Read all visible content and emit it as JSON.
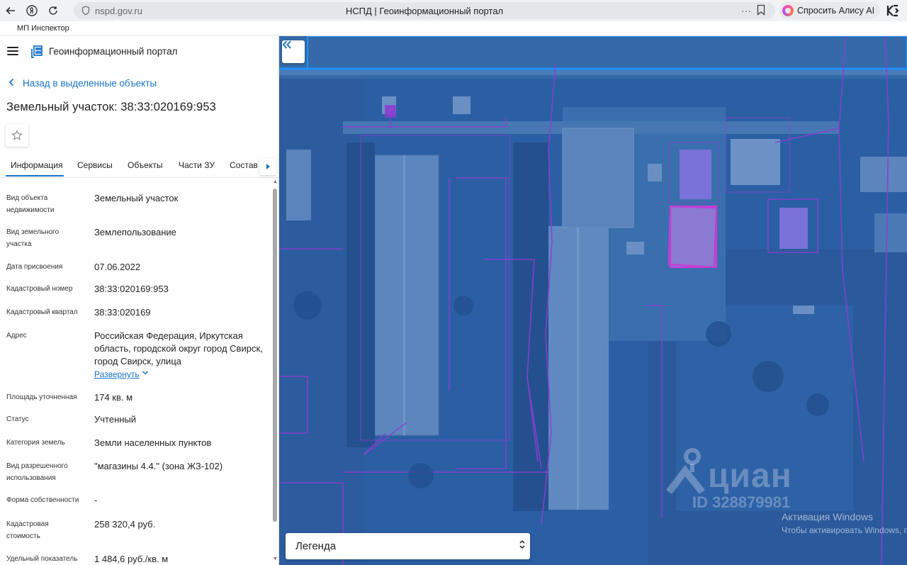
{
  "browser": {
    "url": "nspd.gov.ru",
    "tab_title": "НСПД | Геоинформационный портал",
    "more": "···",
    "alice_label": "Спросить Алису AI",
    "bookmark": "МП Инспектор"
  },
  "header": {
    "app_name": "Геоинформационный портал"
  },
  "panel": {
    "back_label": "Назад в выделенные объекты",
    "title": "Земельный участок: 38:33:020169:953",
    "tabs": [
      "Информация",
      "Сервисы",
      "Объекты",
      "Части ЗУ",
      "Состав"
    ],
    "active_tab": "Информация",
    "rows": [
      {
        "key": "Вид объекта недвижимости",
        "value": "Земельный участок"
      },
      {
        "key": "Вид земельного участка",
        "value": "Землепользование"
      },
      {
        "key": "Дата присвоения",
        "value": "07.06.2022"
      },
      {
        "key": "Кадастровый номер",
        "value": "38:33:020169:953"
      },
      {
        "key": "Кадастровый квартал",
        "value": "38:33:020169"
      },
      {
        "key": "Адрес",
        "value": "Российская Федерация, Иркутская область, городской округ город Свирск, город Свирск, улица"
      },
      {
        "key": "Площадь уточненная",
        "value": "174 кв. м"
      },
      {
        "key": "Статус",
        "value": "Учтенный"
      },
      {
        "key": "Категория земель",
        "value": "Земли населенных пунктов"
      },
      {
        "key": "Вид разрешенного использования",
        "value": "\"магазины 4.4.\" (зона ЖЗ-102)"
      },
      {
        "key": "Форма собственности",
        "value": "-"
      },
      {
        "key": "Кадастровая стоимость",
        "value": "258 320,4 руб."
      },
      {
        "key": "Удельный показатель",
        "value": "1 484,6 руб./кв. м"
      }
    ],
    "expand_label": "Развернуть"
  },
  "map": {
    "legend_label": "Легенда",
    "watermark_name": "циан",
    "watermark_id": "ID 328879981",
    "os_notice_title": "Активация Windows",
    "os_notice_text": "Чтобы активировать Windows, п"
  },
  "colors": {
    "accent": "#1a73c8",
    "map_tint": "#2a5ea3",
    "parcel_line": "#8a3fd1",
    "selected_parcel": "#c83ad6",
    "highlight_border": "#1e90ff"
  }
}
